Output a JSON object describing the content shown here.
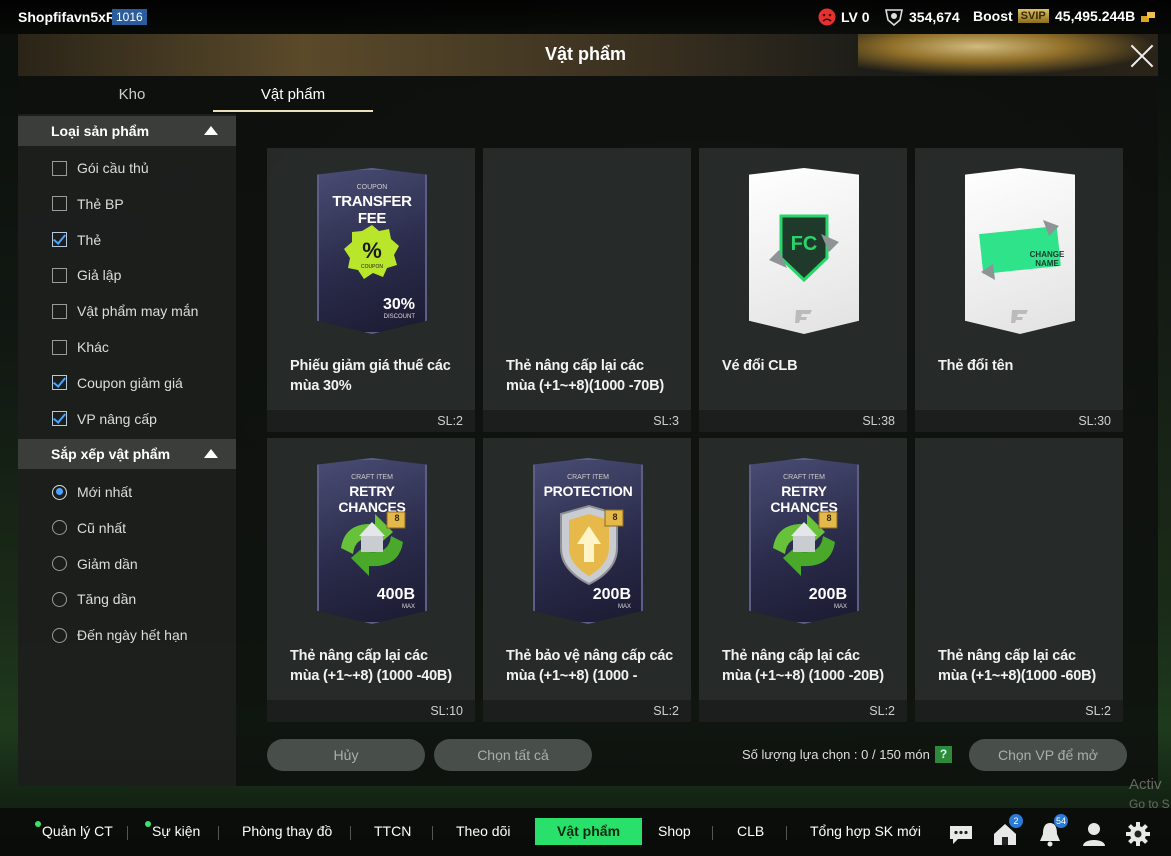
{
  "topbar": {
    "username": "Shopfifavn5xR",
    "user_level": "1016",
    "lv_label": "LV 0",
    "coins": "354,674",
    "boost_label": "Boost",
    "svip_label": "SVIP",
    "balance": "45,495.244B"
  },
  "panel": {
    "title": "Vật phẩm",
    "tabs": [
      {
        "label": "Kho"
      },
      {
        "label": "Vật phẩm"
      }
    ]
  },
  "sidebar": {
    "product_type": {
      "heading": "Loại sản phẩm",
      "items": [
        {
          "label": "Gói cầu thủ",
          "checked": false
        },
        {
          "label": "Thẻ BP",
          "checked": false
        },
        {
          "label": "Thẻ",
          "checked": true
        },
        {
          "label": "Giả lập",
          "checked": false
        },
        {
          "label": "Vật phẩm may mắn",
          "checked": false
        },
        {
          "label": "Khác",
          "checked": false
        },
        {
          "label": "Coupon giảm giá",
          "checked": true
        },
        {
          "label": "VP nâng cấp",
          "checked": true
        }
      ]
    },
    "sort": {
      "heading": "Sắp xếp vật phẩm",
      "items": [
        {
          "label": "Mới nhất",
          "selected": true
        },
        {
          "label": "Cũ nhất",
          "selected": false
        },
        {
          "label": "Giảm dần",
          "selected": false
        },
        {
          "label": "Tăng dần",
          "selected": false
        },
        {
          "label": "Đến ngày hết hạn",
          "selected": false
        }
      ]
    }
  },
  "items": [
    {
      "name": "Phiếu giảm giá thuế các mùa 30%",
      "qty": "SL:2",
      "art": {
        "kind": "coupon",
        "small": "COUPON",
        "title": "TRANSFER FEE",
        "value": "30%",
        "sub": "DISCOUNT",
        "badge": "%",
        "badge_sub": "COUPON"
      }
    },
    {
      "name": "Thẻ nâng cấp lại các mùa (+1~+8)(1000 -70B)",
      "qty": "SL:3",
      "art": {
        "kind": "none"
      }
    },
    {
      "name": "Vé đổi CLB",
      "qty": "SL:38",
      "art": {
        "kind": "club"
      }
    },
    {
      "name": "Thẻ đổi tên",
      "qty": "SL:30",
      "art": {
        "kind": "rename",
        "tag": "CHANGE NAME"
      }
    },
    {
      "name": "Thẻ nâng cấp lại các mùa (+1~+8) (1000 -40B)",
      "qty": "SL:10",
      "art": {
        "kind": "retry",
        "small": "CRAFT ITEM",
        "title": "RETRY CHANCES",
        "value": "400B",
        "sub": "MAX",
        "level": "8"
      }
    },
    {
      "name": "Thẻ bảo vệ nâng cấp các mùa (+1~+8) (1000 -",
      "qty": "SL:2",
      "art": {
        "kind": "protect",
        "small": "CRAFT ITEM",
        "title": "PROTECTION",
        "value": "200B",
        "sub": "MAX",
        "level": "8"
      }
    },
    {
      "name": "Thẻ nâng cấp lại các mùa (+1~+8) (1000 -20B)",
      "qty": "SL:2",
      "art": {
        "kind": "retry",
        "small": "CRAFT ITEM",
        "title": "RETRY CHANCES",
        "value": "200B",
        "sub": "MAX",
        "level": "8"
      }
    },
    {
      "name": "Thẻ nâng cấp lại các mùa (+1~+8)(1000 -60B)",
      "qty": "SL:2",
      "art": {
        "kind": "none"
      }
    }
  ],
  "actions": {
    "cancel": "Hủy",
    "select_all": "Chọn tất cả",
    "selection_count": "Số lượng lựa chọn : 0 / 150 món",
    "help": "?",
    "choose_open": "Chọn VP để mở"
  },
  "nav": {
    "items": [
      "Quản lý CT",
      "Sự kiện",
      "Phòng thay đồ",
      "TTCN",
      "Theo dõi",
      "Vật phẩm",
      "Shop",
      "CLB",
      "Tổng hợp SK mới"
    ],
    "home_badge": "2",
    "bell_badge": "54"
  },
  "watermark": {
    "line1": "Activ",
    "line2": "Go to S"
  },
  "colors": {
    "accent": "#28e06a",
    "check": "#4aa3ff"
  }
}
